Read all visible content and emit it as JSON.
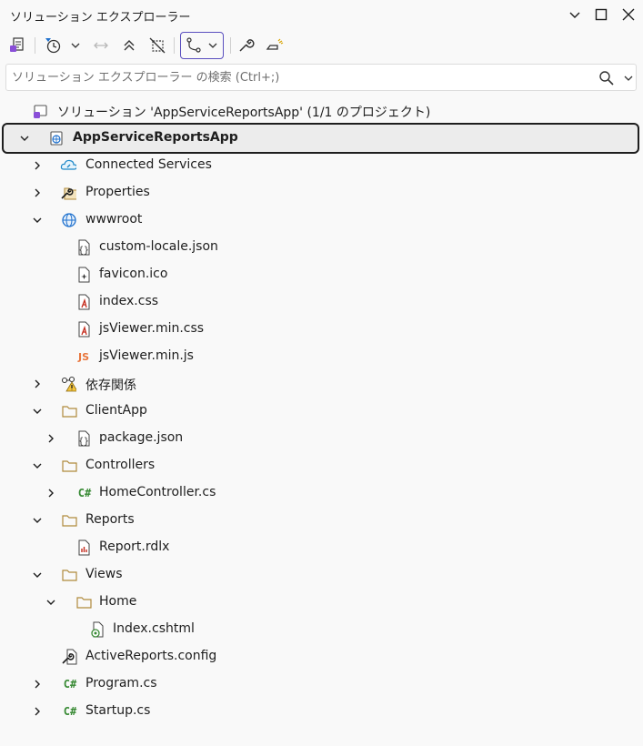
{
  "window": {
    "title": "ソリューション エクスプローラー"
  },
  "search": {
    "placeholder": "ソリューション エクスプローラー の検索 (Ctrl+;)"
  },
  "colors": {
    "accent": "#7160e8",
    "folder": "#dcb67a",
    "csharp": "#388a34",
    "js": "#e8753c",
    "css": "#c42b1c",
    "globe": "#1e70cd"
  },
  "tree": {
    "solution": "ソリューション 'AppServiceReportsApp' (1/1 のプロジェクト)",
    "project": "AppServiceReportsApp",
    "items": [
      {
        "label": "Connected Services",
        "icon": "cloud-icon"
      },
      {
        "label": "Properties",
        "icon": "wrench-folder-icon"
      },
      {
        "label": "wwwroot",
        "icon": "globe-icon"
      },
      {
        "label": "custom-locale.json",
        "icon": "json-file-icon"
      },
      {
        "label": "favicon.ico",
        "icon": "ico-file-icon"
      },
      {
        "label": "index.css",
        "icon": "css-file-icon"
      },
      {
        "label": "jsViewer.min.css",
        "icon": "css-file-icon"
      },
      {
        "label": "jsViewer.min.js",
        "icon": "js-file-icon"
      },
      {
        "label": "依存関係",
        "icon": "dependencies-warning-icon"
      },
      {
        "label": "ClientApp",
        "icon": "folder-icon"
      },
      {
        "label": "package.json",
        "icon": "json-file-icon"
      },
      {
        "label": "Controllers",
        "icon": "folder-icon"
      },
      {
        "label": "HomeController.cs",
        "icon": "csharp-file-icon"
      },
      {
        "label": "Reports",
        "icon": "folder-icon"
      },
      {
        "label": "Report.rdlx",
        "icon": "report-file-icon"
      },
      {
        "label": "Views",
        "icon": "folder-icon"
      },
      {
        "label": "Home",
        "icon": "folder-icon"
      },
      {
        "label": "Index.cshtml",
        "icon": "razor-file-icon"
      },
      {
        "label": "ActiveReports.config",
        "icon": "config-file-icon"
      },
      {
        "label": "Program.cs",
        "icon": "csharp-file-icon"
      },
      {
        "label": "Startup.cs",
        "icon": "csharp-file-icon"
      }
    ]
  }
}
